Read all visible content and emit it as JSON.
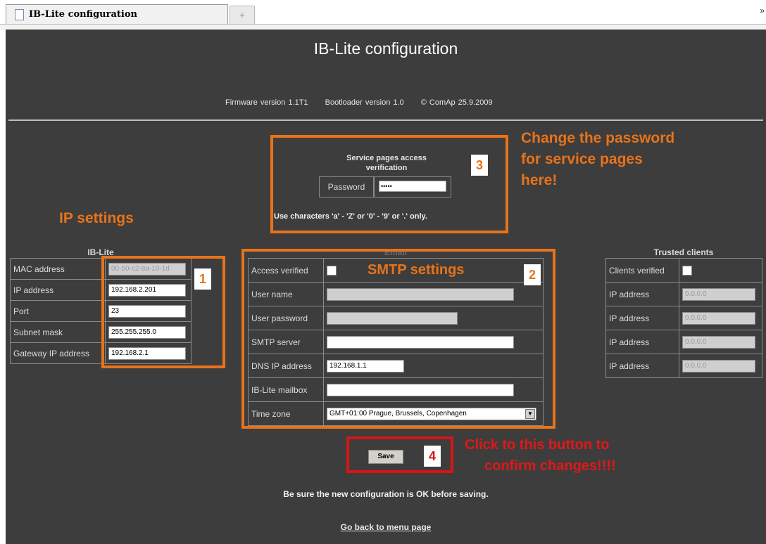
{
  "browser": {
    "tab_title": "IB-Lite configuration",
    "new_tab_symbol": "+",
    "scroll_symbol": "»"
  },
  "page": {
    "title": "IB-Lite configuration",
    "firmware": "Firmware version 1.1T1",
    "bootloader": "Bootloader version 1.0",
    "copyright": "© ComAp  25.9.2009"
  },
  "service": {
    "heading": "Service pages access verification",
    "password_label": "Password",
    "password_value": "•••••",
    "hint": "Use characters 'a' - 'Z' or '0' - '9' or '.' only."
  },
  "annotations": {
    "change_password": [
      "Change the password",
      "for service pages",
      "here!"
    ],
    "ip_settings": "IP settings",
    "smtp_settings": "SMTP settings",
    "confirm": [
      "Click to this button to",
      "confirm changes!!!!"
    ],
    "num1": "1",
    "num2": "2",
    "num3": "3",
    "num4": "4",
    "orange_color": "#e8731a",
    "red_color": "#d71515"
  },
  "iblite": {
    "title": "IB-Lite",
    "rows": [
      {
        "label": "MAC address",
        "value": "00-50-c2-8a-10-1d",
        "disabled": true
      },
      {
        "label": "IP address",
        "value": "192.168.2.201",
        "disabled": false
      },
      {
        "label": "Port",
        "value": "23",
        "disabled": false
      },
      {
        "label": "Subnet mask",
        "value": "255.255.255.0",
        "disabled": false
      },
      {
        "label": "Gateway IP address",
        "value": "192.168.2.1",
        "disabled": false
      }
    ]
  },
  "email": {
    "title": "Email",
    "access_verified_label": "Access verified",
    "user_name_label": "User name",
    "user_password_label": "User password",
    "smtp_server_label": "SMTP server",
    "dns_label": "DNS IP address",
    "dns_value": "192.168.1.1",
    "mailbox_label": "IB-Lite mailbox",
    "timezone_label": "Time zone",
    "timezone_value": "GMT+01:00 Prague, Brussels, Copenhagen",
    "select_arrow": "▼"
  },
  "trusted": {
    "title": "Trusted clients",
    "clients_verified_label": "Clients verified",
    "rows": [
      {
        "label": "IP address",
        "value": "0.0.0.0"
      },
      {
        "label": "IP address",
        "value": "0.0.0.0"
      },
      {
        "label": "IP address",
        "value": "0.0.0.0"
      },
      {
        "label": "IP address",
        "value": "0.0.0.0"
      }
    ]
  },
  "footer": {
    "save_label": "Save",
    "warning": "Be sure the new configuration is OK before saving.",
    "back_link": "Go back to menu page"
  }
}
